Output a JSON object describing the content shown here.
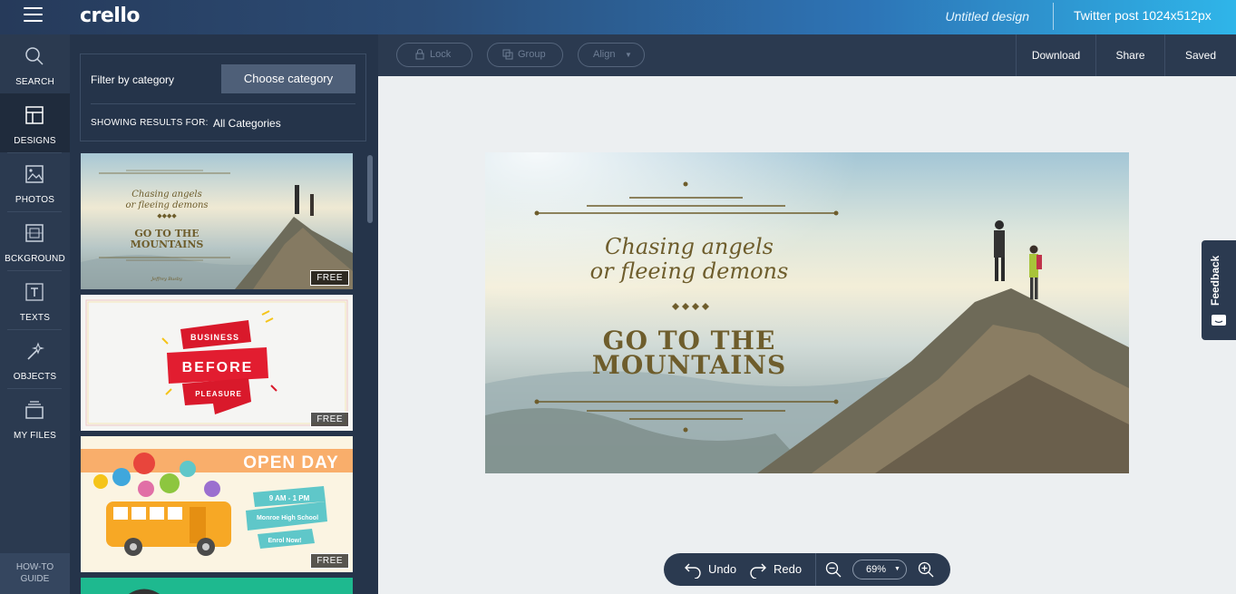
{
  "app": {
    "logo": "crello",
    "doc_title": "Untitled design",
    "doc_size": "Twitter post 1024x512px"
  },
  "rail": {
    "items": [
      {
        "label": "SEARCH",
        "icon": "search-icon"
      },
      {
        "label": "DESIGNS",
        "icon": "designs-icon"
      },
      {
        "label": "PHOTOS",
        "icon": "photos-icon"
      },
      {
        "label": "BCKGROUND",
        "icon": "background-icon"
      },
      {
        "label": "TEXTS",
        "icon": "text-icon"
      },
      {
        "label": "OBJECTS",
        "icon": "objects-icon"
      },
      {
        "label": "MY FILES",
        "icon": "files-icon"
      }
    ],
    "howto_line1": "HOW-TO",
    "howto_line2": "GUIDE"
  },
  "panel": {
    "filter_label": "Filter by category",
    "choose_label": "Choose category",
    "showing_label": "SHOWING RESULTS FOR:",
    "showing_value": "All Categories",
    "free_label": "FREE",
    "thumbs": [
      {
        "line1": "Chasing angels",
        "line2": "or fleeing demons",
        "title1": "GO TO THE",
        "title2": "MOUNTAINS",
        "sig": "Jeffrey Busby"
      },
      {
        "top": "BUSINESS",
        "mid": "BEFORE",
        "bottom": "PLEASURE"
      },
      {
        "title": "OPEN DAY",
        "time": "9 AM - 1 PM",
        "school": "Monroe High School",
        "cta": "Enrol Now!"
      }
    ]
  },
  "toolbar": {
    "lock": "Lock",
    "group": "Group",
    "align": "Align",
    "download": "Download",
    "share": "Share",
    "saved": "Saved"
  },
  "canvas": {
    "line1": "Chasing angels",
    "line2": "or fleeing demons",
    "title1": "GO TO THE",
    "title2": "MOUNTAINS",
    "accent": "#6e5d2c"
  },
  "feedback": {
    "label": "Feedback"
  },
  "bottom": {
    "undo": "Undo",
    "redo": "Redo",
    "zoom": "69%"
  }
}
